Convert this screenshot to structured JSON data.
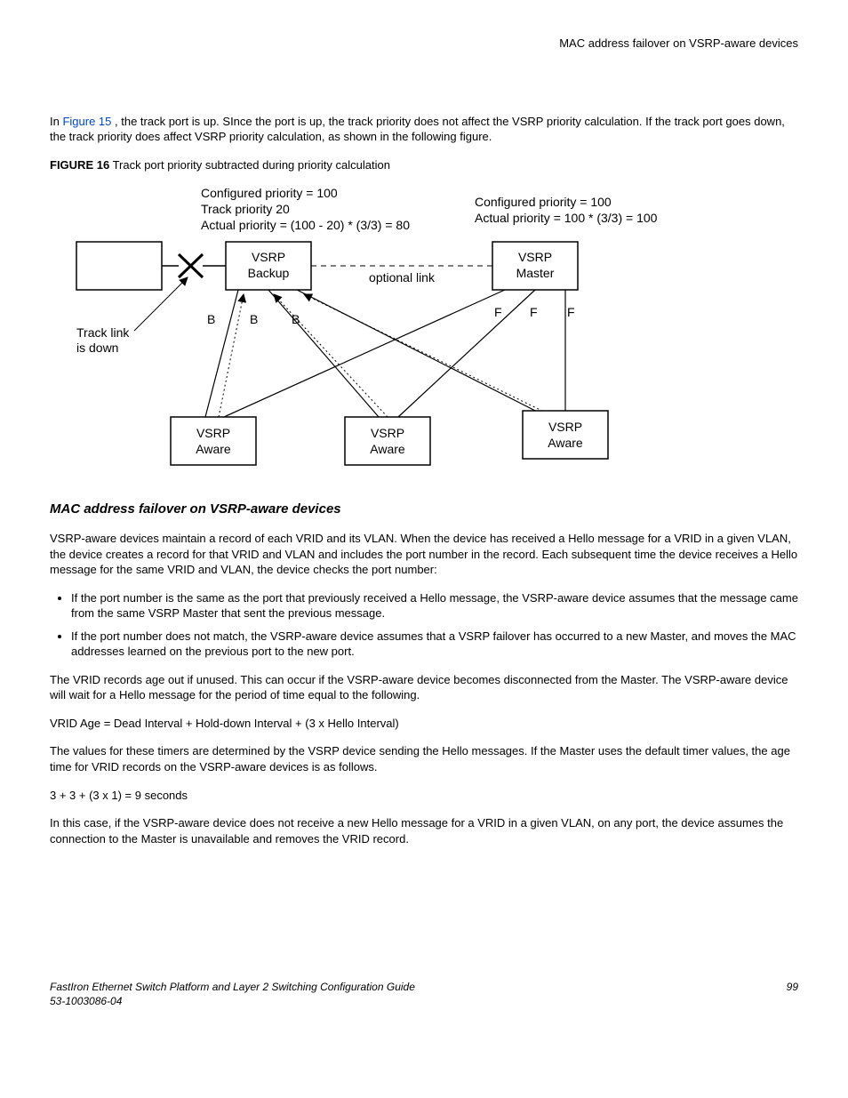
{
  "header": {
    "right": "MAC address failover on VSRP-aware devices"
  },
  "intro": {
    "pre": "In ",
    "link": "Figure 15 ",
    "post": ", the track port is up. SInce the port is up, the track priority does not affect the VSRP priority calculation. If the track port goes down, the track priority does affect VSRP priority calculation, as shown in the following figure."
  },
  "figure": {
    "label": "FIGURE 16",
    "caption": " Track port priority subtracted during priority calculation"
  },
  "diagram": {
    "left_lines": {
      "l1": "Configured priority = 100",
      "l2": "Track priority 20",
      "l3": "Actual priority = (100 - 20) * (3/3) = 80"
    },
    "right_lines": {
      "l1": "Configured priority = 100",
      "l2": "Actual priority = 100 * (3/3) = 100"
    },
    "vsrp_backup": "VSRP\nBackup",
    "vsrp_master": "VSRP\nMaster",
    "optional_link": "optional link",
    "track_link": "Track link\nis down",
    "B": "B",
    "F": "F",
    "vsrp_aware": "VSRP\nAware"
  },
  "section": {
    "title": "MAC address failover on VSRP-aware devices",
    "p1": "VSRP-aware devices maintain a record of each VRID and its VLAN. When the device has received a Hello message for a VRID in a given VLAN, the device creates a record for that VRID and VLAN and includes the port number in the record. Each subsequent time the device receives a Hello message for the same VRID and VLAN, the device checks the port number:",
    "b1": "If the port number is the same as the port that previously received a Hello message, the VSRP-aware device assumes that the message came from the same VSRP Master that sent the previous message.",
    "b2": "If the port number does not match, the VSRP-aware device assumes that a VSRP failover has occurred to a new Master, and moves the MAC addresses learned on the previous port to the new port.",
    "p2": "The VRID records age out if unused. This can occur if the VSRP-aware device becomes disconnected from the Master. The VSRP-aware device will wait for a Hello message for the period of time equal to the following.",
    "p3": "VRID Age = Dead Interval + Hold-down Interval + (3 x Hello Interval)",
    "p4": "The values for these timers are determined by the VSRP device sending the Hello messages. If the Master uses the default timer values, the age time for VRID records on the VSRP-aware devices is as follows.",
    "p5": "3 + 3 + (3 x 1) = 9 seconds",
    "p6": "In this case, if the VSRP-aware device does not receive a new Hello message for a VRID in a given VLAN, on any port, the device assumes the connection to the Master is unavailable and removes the VRID record."
  },
  "footer": {
    "title": "FastIron Ethernet Switch Platform and Layer 2 Switching Configuration Guide",
    "doc": "53-1003086-04",
    "page": "99"
  }
}
